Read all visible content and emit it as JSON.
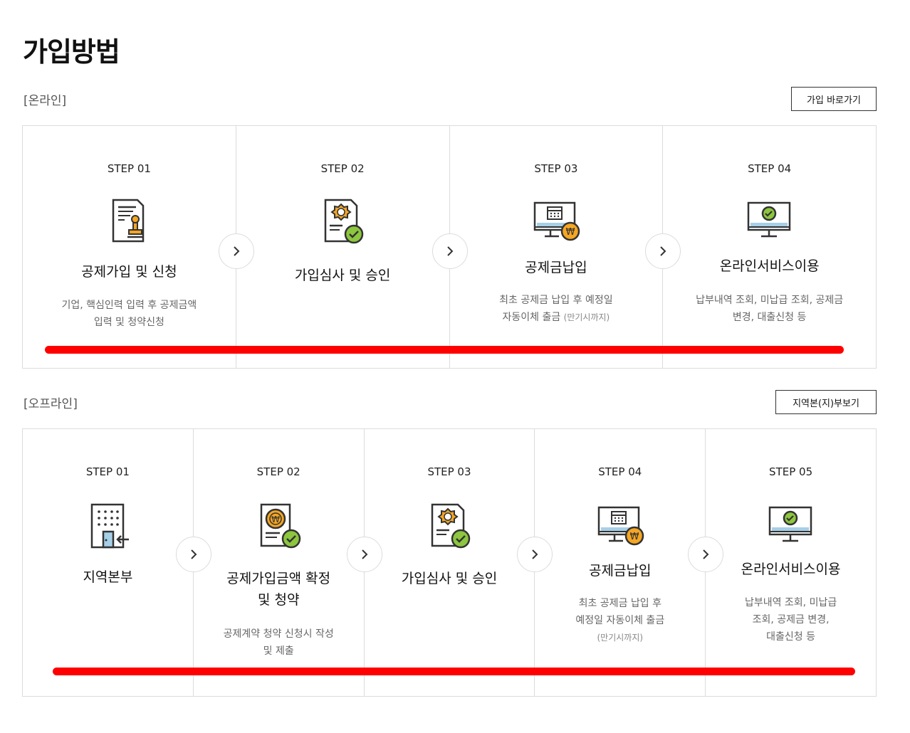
{
  "page_title": "가입방법",
  "online": {
    "label": "[온라인]",
    "button": "가입 바로가기",
    "steps": [
      {
        "step": "STEP 01",
        "title": "공제가입 및 신청",
        "desc1": "기업, 핵심인력 입력 후 공제금액",
        "desc2": "입력 및 청약신청",
        "desc2_small": "",
        "icon": "document-stamp-icon"
      },
      {
        "step": "STEP 02",
        "title": "가입심사 및 승인",
        "desc1": "",
        "desc2": "",
        "desc2_small": "",
        "icon": "certificate-check-icon"
      },
      {
        "step": "STEP 03",
        "title": "공제금납입",
        "desc1": "최초 공제금 납입 후 예정일",
        "desc2": "자동이체 출금",
        "desc2_small": "(만기시까지)",
        "icon": "monitor-calendar-won-icon"
      },
      {
        "step": "STEP 04",
        "title": "온라인서비스이용",
        "desc1": "납부내역 조회, 미납급 조회, 공제금",
        "desc2": "변경, 대출신청 등",
        "desc2_small": "",
        "icon": "monitor-check-icon"
      }
    ]
  },
  "offline": {
    "label": "[오프라인]",
    "button": "지역본(지)부보기",
    "steps": [
      {
        "step": "STEP 01",
        "title1": "지역본부",
        "title2": "",
        "desc1": "",
        "desc2": "",
        "desc3": "",
        "icon": "building-door-icon"
      },
      {
        "step": "STEP 02",
        "title1": "공제가입금액 확정",
        "title2": "및 청약",
        "desc1": "공제계약 청약 신청시 작성",
        "desc2": "및 제출",
        "desc3": "",
        "icon": "document-won-check-icon"
      },
      {
        "step": "STEP 03",
        "title1": "가입심사 및 승인",
        "title2": "",
        "desc1": "",
        "desc2": "",
        "desc3": "",
        "icon": "certificate-check-icon"
      },
      {
        "step": "STEP 04",
        "title1": "공제금납입",
        "title2": "",
        "desc1": "최초 공제금 납입 후",
        "desc2": "예정일 자동이체 출금",
        "desc3": "(만기시까지)",
        "icon": "monitor-calendar-won-icon"
      },
      {
        "step": "STEP 05",
        "title1": "온라인서비스이용",
        "title2": "",
        "desc1": "납부내역 조회, 미납급",
        "desc2": "조회, 공제금 변경,",
        "desc3": "대출신청 등",
        "icon": "monitor-check-icon"
      }
    ]
  },
  "colors": {
    "accent": "#f5a623",
    "check": "#8dc63f",
    "screen": "#a6cfe8",
    "highlight": "#ff0000"
  }
}
